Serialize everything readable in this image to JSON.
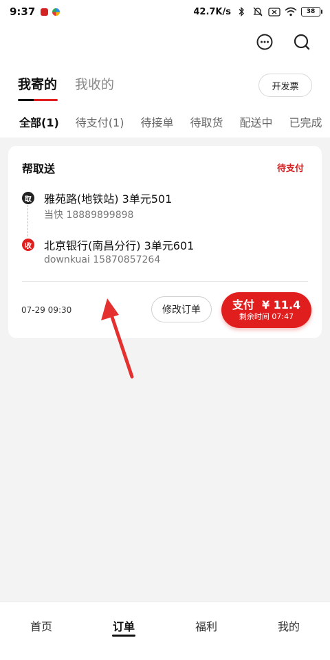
{
  "status_bar": {
    "time": "9:37",
    "network_speed": "42.7K/s",
    "battery": "38"
  },
  "header": {
    "tabs": [
      {
        "label": "我寄的",
        "active": true
      },
      {
        "label": "我收的",
        "active": false
      }
    ],
    "invoice_label": "开发票"
  },
  "status_tabs": [
    {
      "label": "全部(1)",
      "active": true
    },
    {
      "label": "待支付(1)",
      "active": false
    },
    {
      "label": "待接单",
      "active": false
    },
    {
      "label": "待取货",
      "active": false
    },
    {
      "label": "配送中",
      "active": false
    },
    {
      "label": "已完成",
      "active": false
    }
  ],
  "order": {
    "service": "帮取送",
    "status": "待支付",
    "pickup": {
      "badge": "取",
      "address": "雅苑路(地铁站) 3单元501",
      "contact": "当快 18889899898"
    },
    "delivery": {
      "badge": "收",
      "address": "北京银行(南昌分行) 3单元601",
      "contact": "downkuai 15870857264"
    },
    "time": "07-29 09:30",
    "modify_label": "修改订单",
    "pay_label": "支付  ¥ 11.4",
    "pay_countdown": "剩余时间 07:47"
  },
  "bottom_nav": [
    {
      "label": "首页",
      "active": false
    },
    {
      "label": "订单",
      "active": true
    },
    {
      "label": "福利",
      "active": false
    },
    {
      "label": "我的",
      "active": false
    }
  ],
  "colors": {
    "accent": "#e01e1e",
    "pickup_badge": "#222222",
    "delivery_badge": "#e01e1e"
  }
}
